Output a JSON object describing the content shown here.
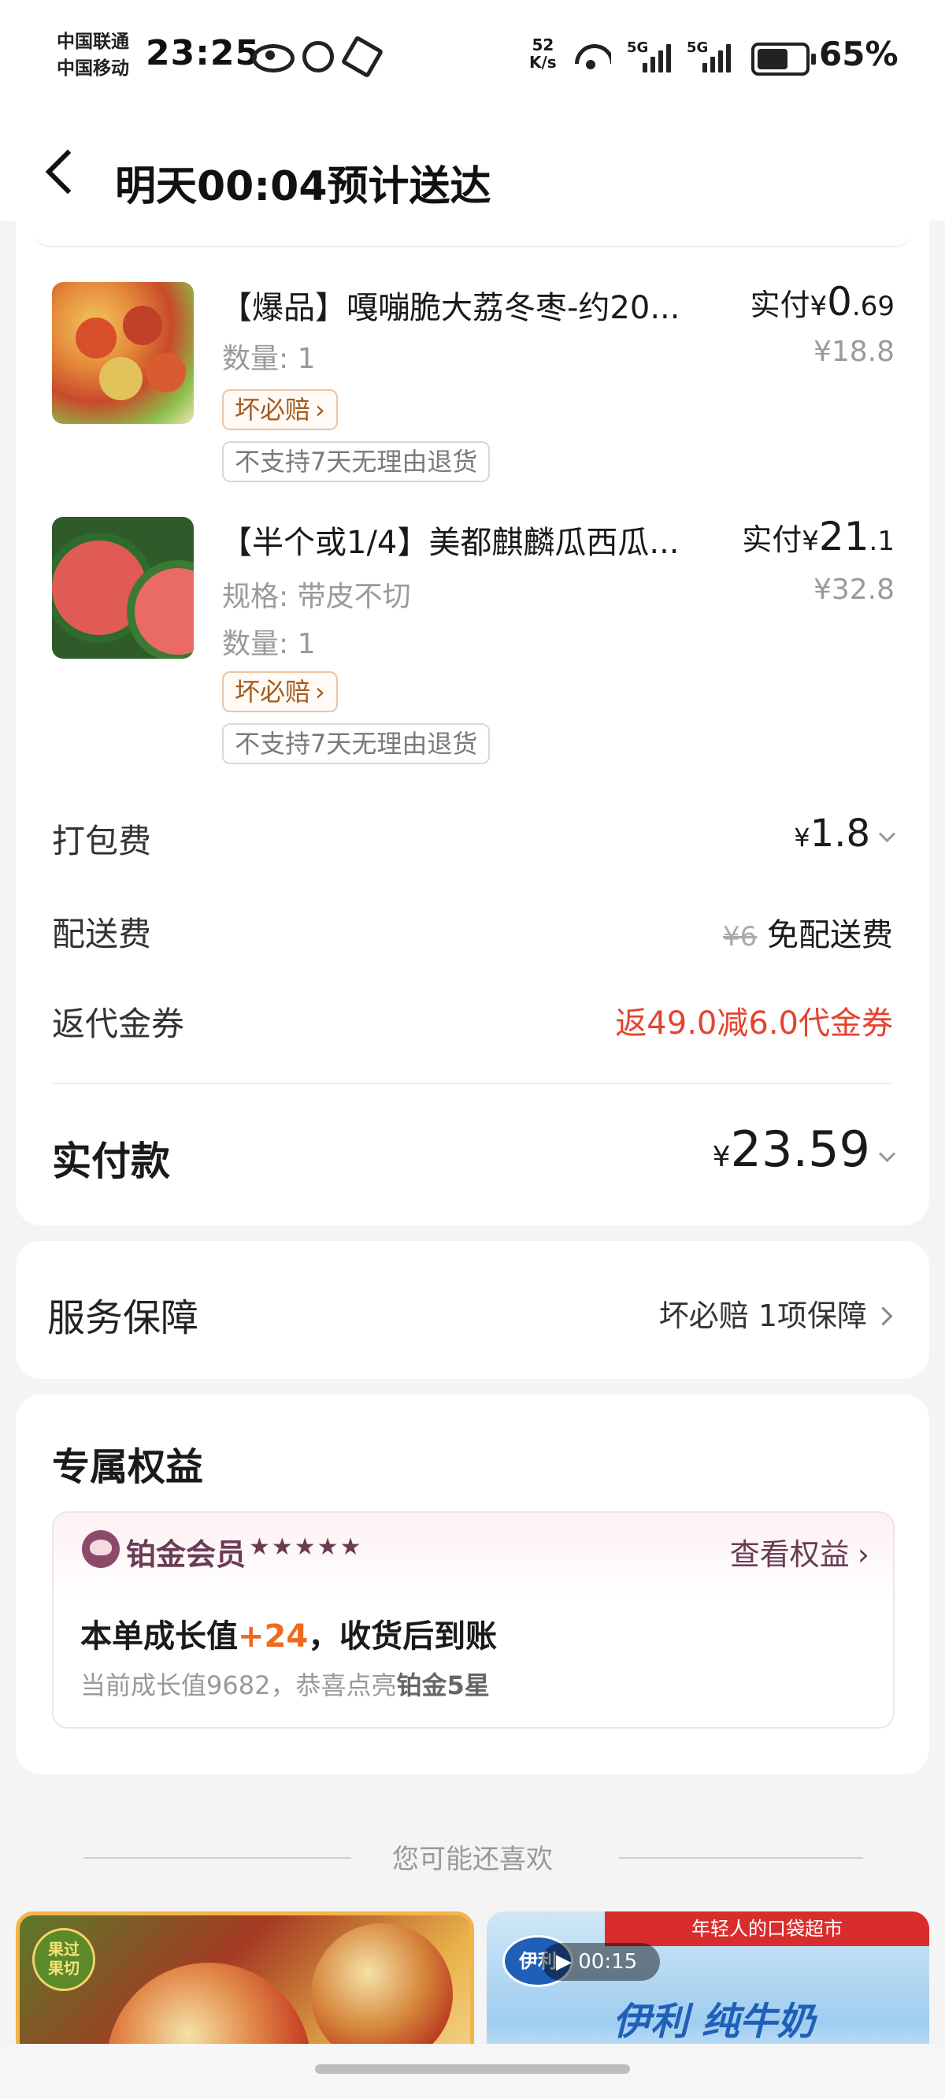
{
  "status_bar": {
    "carrier1": "中国联通",
    "carrier2": "中国移动",
    "time": "23:25",
    "net_speed_value": "52",
    "net_speed_unit": "K/s",
    "battery": "65%"
  },
  "header": {
    "title": "明天00:04预计送达"
  },
  "items": [
    {
      "name": "【爆品】嘎嘣脆大荔冬枣-约20...",
      "quantity": "数量: 1",
      "badge_compensation": "坏必赔",
      "badge_return": "不支持7天无理由退货",
      "paid_label": "实付",
      "currency": "¥",
      "paid_int": "0",
      "paid_dec": ".69",
      "original_price": "¥18.8"
    },
    {
      "name": "【半个或1/4】美都麒麟瓜西瓜...",
      "spec": "规格: 带皮不切",
      "quantity": "数量: 1",
      "badge_compensation": "坏必赔",
      "badge_return": "不支持7天无理由退货",
      "paid_label": "实付",
      "currency": "¥",
      "paid_int": "21",
      "paid_dec": ".1",
      "original_price": "¥32.8"
    }
  ],
  "fees": {
    "packing_label": "打包费",
    "packing_currency": "¥",
    "packing_value": "1.8",
    "delivery_label": "配送费",
    "delivery_strike": "¥6",
    "delivery_value": "免配送费",
    "voucher_label": "返代金券",
    "voucher_value": "返49.0减6.0代金券",
    "total_label": "实付款",
    "total_currency": "¥",
    "total_value": "23.59"
  },
  "service": {
    "label": "服务保障",
    "value": "坏必赔 1项保障"
  },
  "benefits": {
    "title": "专属权益",
    "member_level": "铂金会员",
    "stars": "★★★★★",
    "link": "查看权益",
    "growth_prefix": "本单成长值",
    "growth_value": "+24",
    "growth_suffix": "，收货后到账",
    "current_prefix": "当前成长值9682，恭喜点亮",
    "current_highlight": "铂金5星"
  },
  "recommend": {
    "title": "您可能还喜欢",
    "card1_tag_line1": "果过",
    "card1_tag_line2": "果切",
    "card2_banner": "年轻人的口袋超市",
    "card2_brand": "伊利",
    "card2_headline": "伊利  纯牛奶",
    "card2_video_time": "00:15"
  },
  "colors": {
    "accent_red": "#e5432f",
    "growth_orange": "#f06a1e",
    "badge_brown": "#a35a1c",
    "link_purple": "#6a3c54"
  }
}
